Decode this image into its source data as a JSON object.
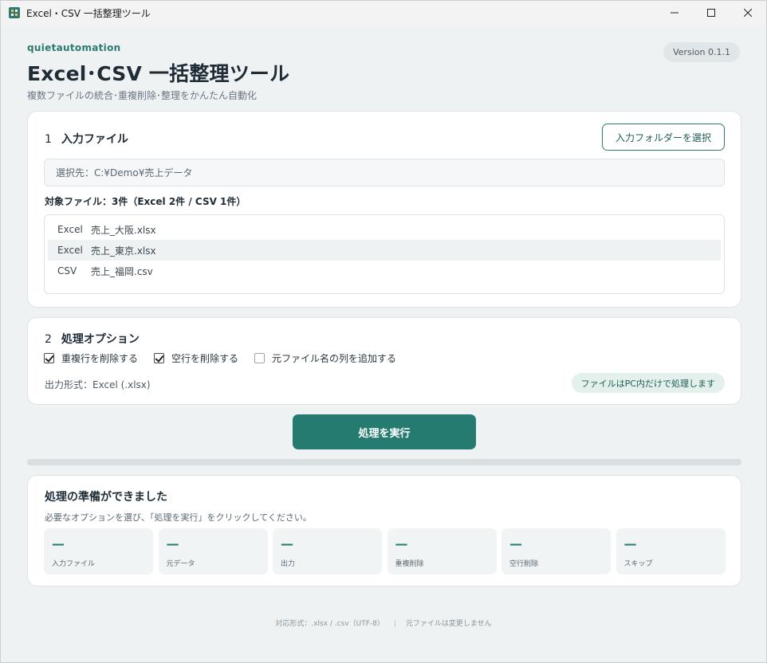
{
  "window": {
    "title": "Excel・CSV 一括整理ツール",
    "minimize_label": "—",
    "maximize_label": "☐",
    "close_label": "✕"
  },
  "header": {
    "brand": "quietautomation",
    "title": "Excel･CSV 一括整理ツール",
    "subtitle": "複数ファイルの統合･重複削除･整理をかんたん自動化",
    "version": "Version 0.1.1"
  },
  "input_section": {
    "number": "1",
    "title": "入力ファイル",
    "select_button": "入力フォルダーを選択",
    "path": "選択先：C:¥Demo¥売上データ",
    "file_count": "対象ファイル：3件（Excel 2件 / CSV 1件）",
    "files": [
      {
        "type": "Excel",
        "name": "売上_大阪.xlsx"
      },
      {
        "type": "Excel",
        "name": "売上_東京.xlsx"
      },
      {
        "type": "CSV",
        "name": "売上_福岡.csv"
      }
    ]
  },
  "options_section": {
    "number": "2",
    "title": "処理オプション",
    "options": [
      {
        "label": "重複行を削除する",
        "checked": true
      },
      {
        "label": "空行を削除する",
        "checked": true
      },
      {
        "label": "元ファイル名の列を追加する",
        "checked": false
      }
    ],
    "output_format": "出力形式：Excel (.xlsx)",
    "local_badge": "ファイルはPC内だけで処理します"
  },
  "run_button": "処理を実行",
  "progress": 0,
  "status": {
    "title": "処理の準備ができました",
    "message": "必要なオプションを選び、「処理を実行」をクリックしてください。",
    "stats": [
      {
        "value": "—",
        "label": "入力ファイル"
      },
      {
        "value": "—",
        "label": "元データ"
      },
      {
        "value": "—",
        "label": "出力"
      },
      {
        "value": "—",
        "label": "重複削除"
      },
      {
        "value": "—",
        "label": "空行削除"
      },
      {
        "value": "—",
        "label": "スキップ"
      }
    ]
  },
  "footer": {
    "formats": "対応形式：.xlsx / .csv（UTF-8）",
    "separator": "|",
    "note": "元ファイルは変更しません"
  },
  "colors": {
    "accent": "#257b70",
    "background": "#eef2f3",
    "card": "#ffffff"
  }
}
